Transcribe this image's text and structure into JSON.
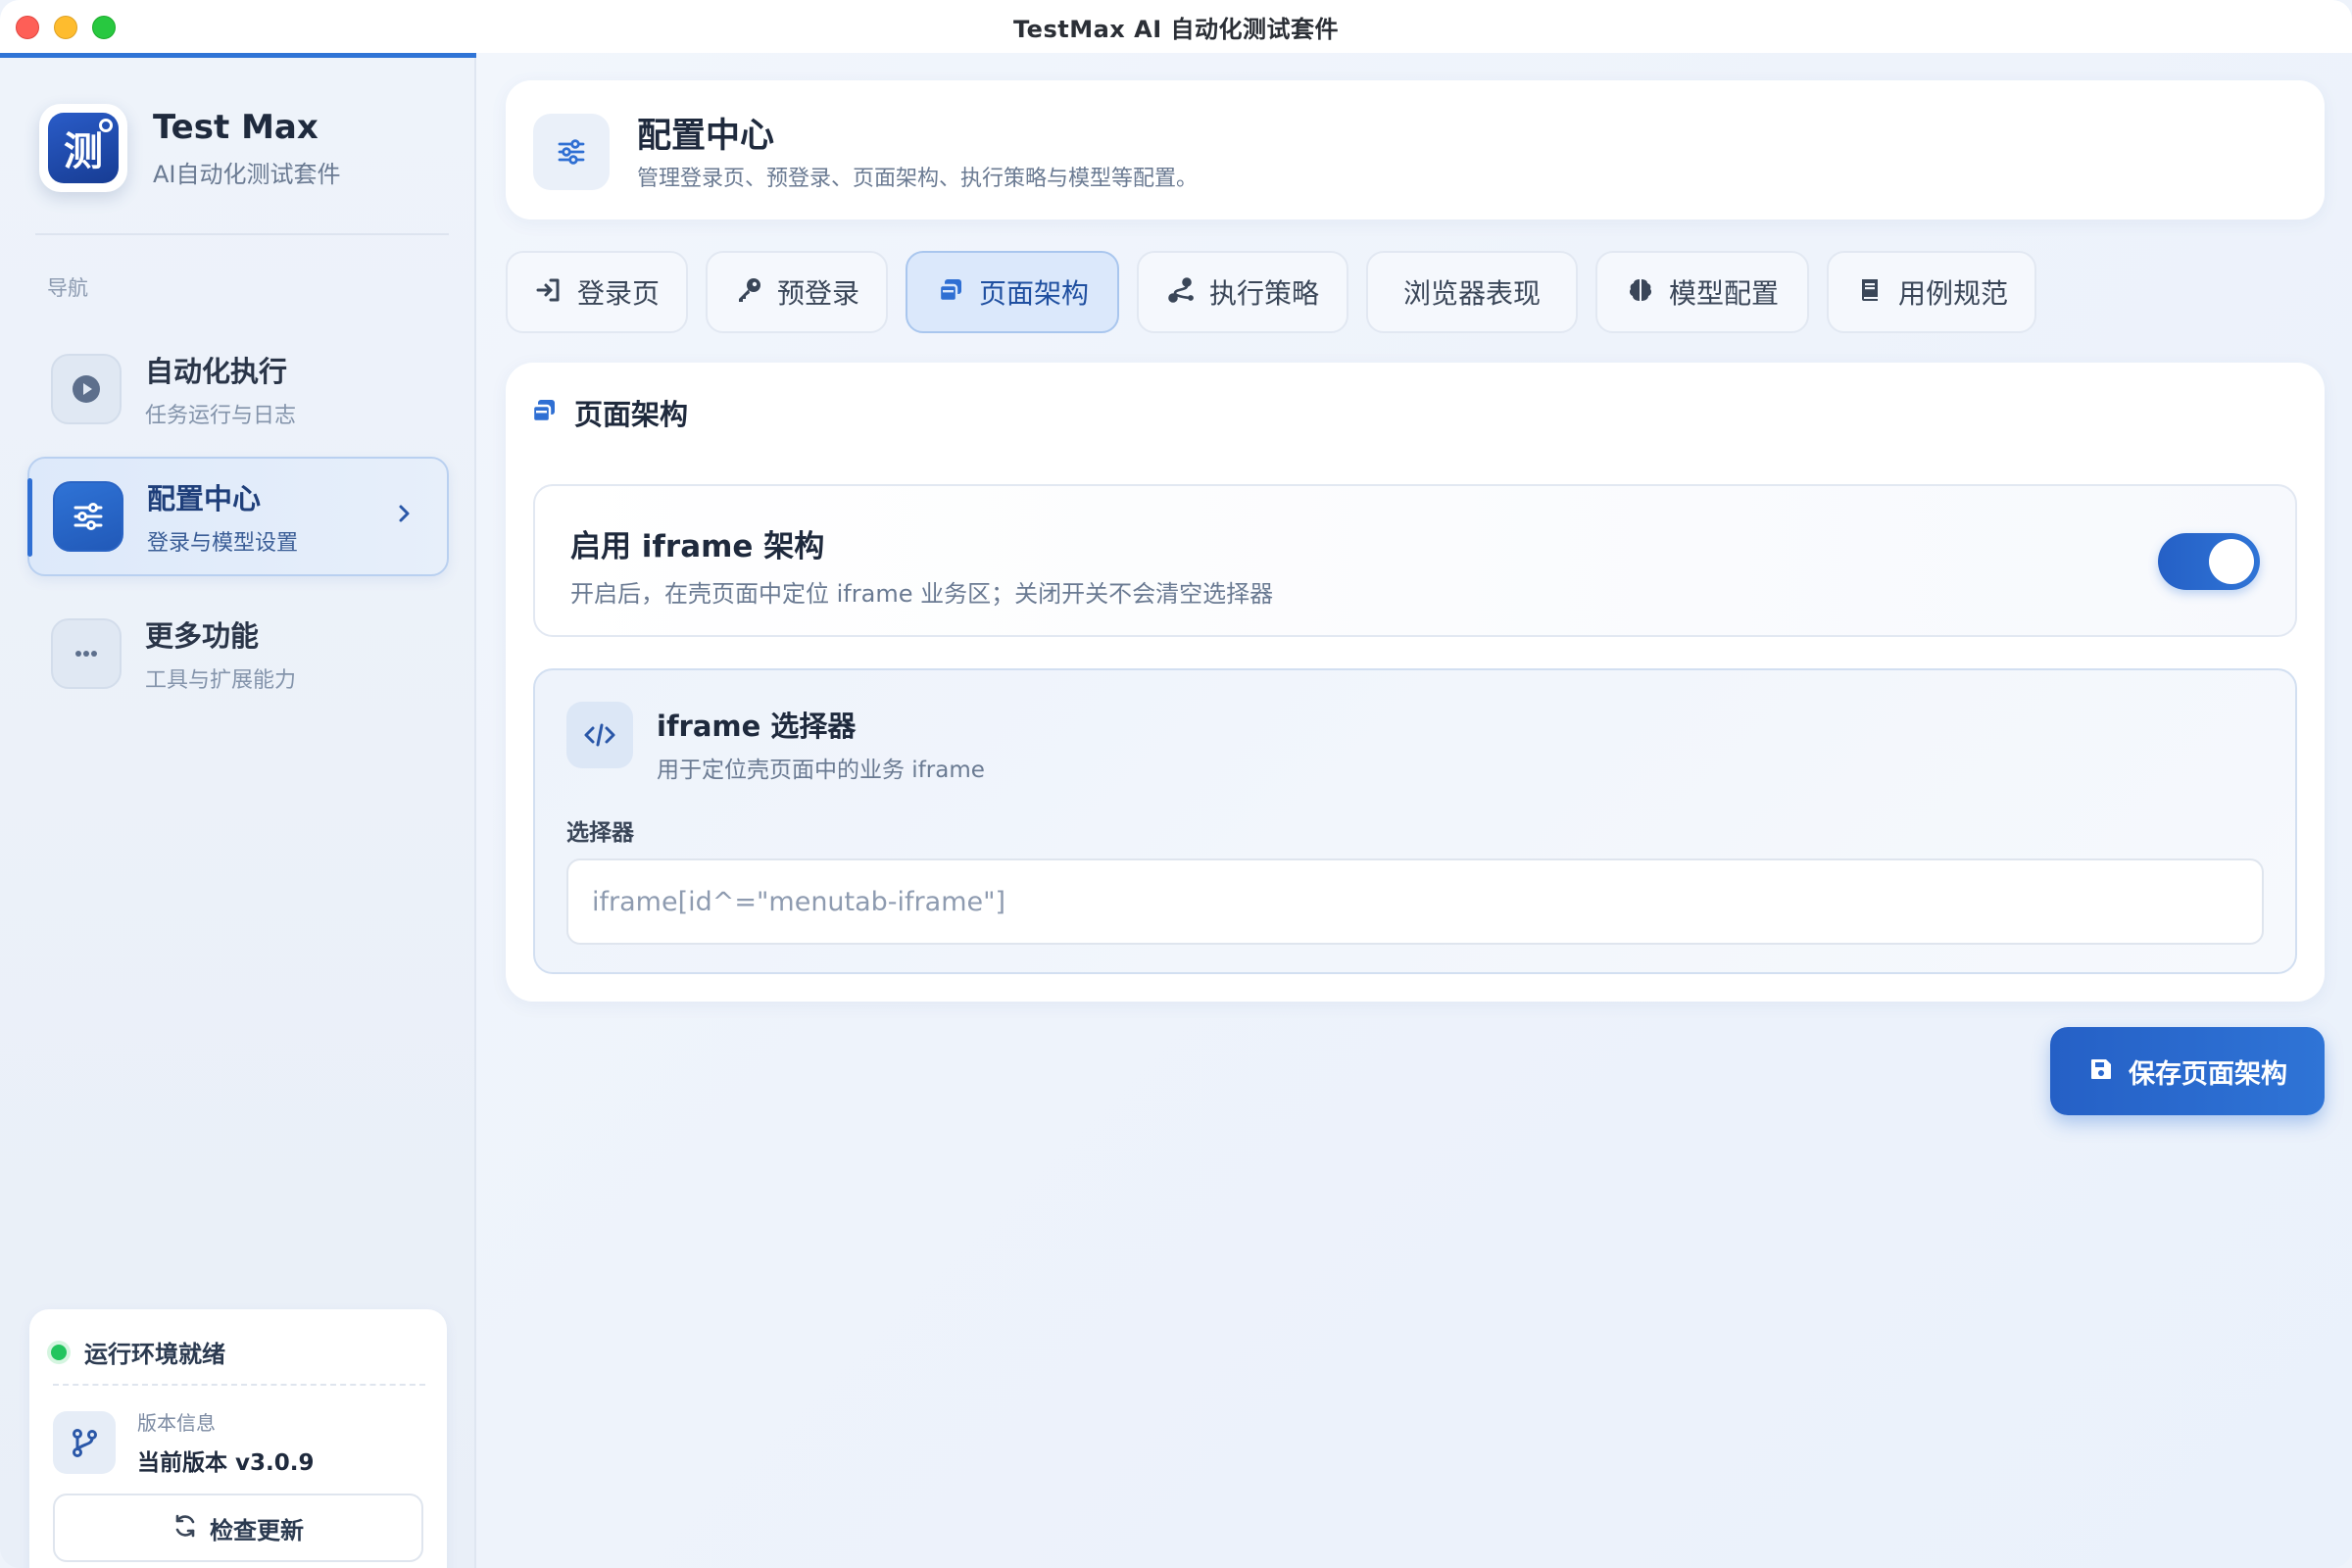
{
  "window": {
    "title": "TestMax AI 自动化测试套件"
  },
  "brand": {
    "logo_char": "测",
    "name": "Test Max",
    "subtitle": "AI自动化测试套件"
  },
  "sidebar": {
    "caption": "导航",
    "items": [
      {
        "title": "自动化执行",
        "subtitle": "任务运行与日志",
        "icon": "play-icon",
        "active": false
      },
      {
        "title": "配置中心",
        "subtitle": "登录与模型设置",
        "icon": "sliders-icon",
        "active": true
      },
      {
        "title": "更多功能",
        "subtitle": "工具与扩展能力",
        "icon": "more-icon",
        "active": false
      }
    ],
    "status": {
      "text": "运行环境就绪",
      "version_label": "版本信息",
      "version_value": "当前版本 v3.0.9",
      "check_update": "检查更新",
      "status_color": "#22c55e"
    }
  },
  "header": {
    "title": "配置中心",
    "subtitle": "管理登录页、预登录、页面架构、执行策略与模型等配置。"
  },
  "tabs": [
    {
      "label": "登录页",
      "icon": "sign-in-icon",
      "active": false
    },
    {
      "label": "预登录",
      "icon": "key-icon",
      "active": false
    },
    {
      "label": "页面架构",
      "icon": "window-icon",
      "active": true
    },
    {
      "label": "执行策略",
      "icon": "route-icon",
      "active": false
    },
    {
      "label": "浏览器表现",
      "icon": "",
      "active": false
    },
    {
      "label": "模型配置",
      "icon": "brain-icon",
      "active": false
    },
    {
      "label": "用例规范",
      "icon": "book-icon",
      "active": false
    }
  ],
  "section": {
    "title": "页面架构",
    "toggle": {
      "title": "启用 iframe 架构",
      "subtitle": "开启后，在壳页面中定位 iframe 业务区；关闭开关不会清空选择器",
      "enabled": true
    },
    "selector": {
      "title": "iframe 选择器",
      "subtitle": "用于定位壳页面中的业务 iframe",
      "label": "选择器",
      "placeholder": "iframe[id^=\"menutab-iframe\"]",
      "value": ""
    }
  },
  "save_button": {
    "label": "保存页面架构"
  },
  "colors": {
    "accent": "#2f74d6",
    "accent_dark": "#2560c6",
    "status_green": "#22c55e"
  }
}
